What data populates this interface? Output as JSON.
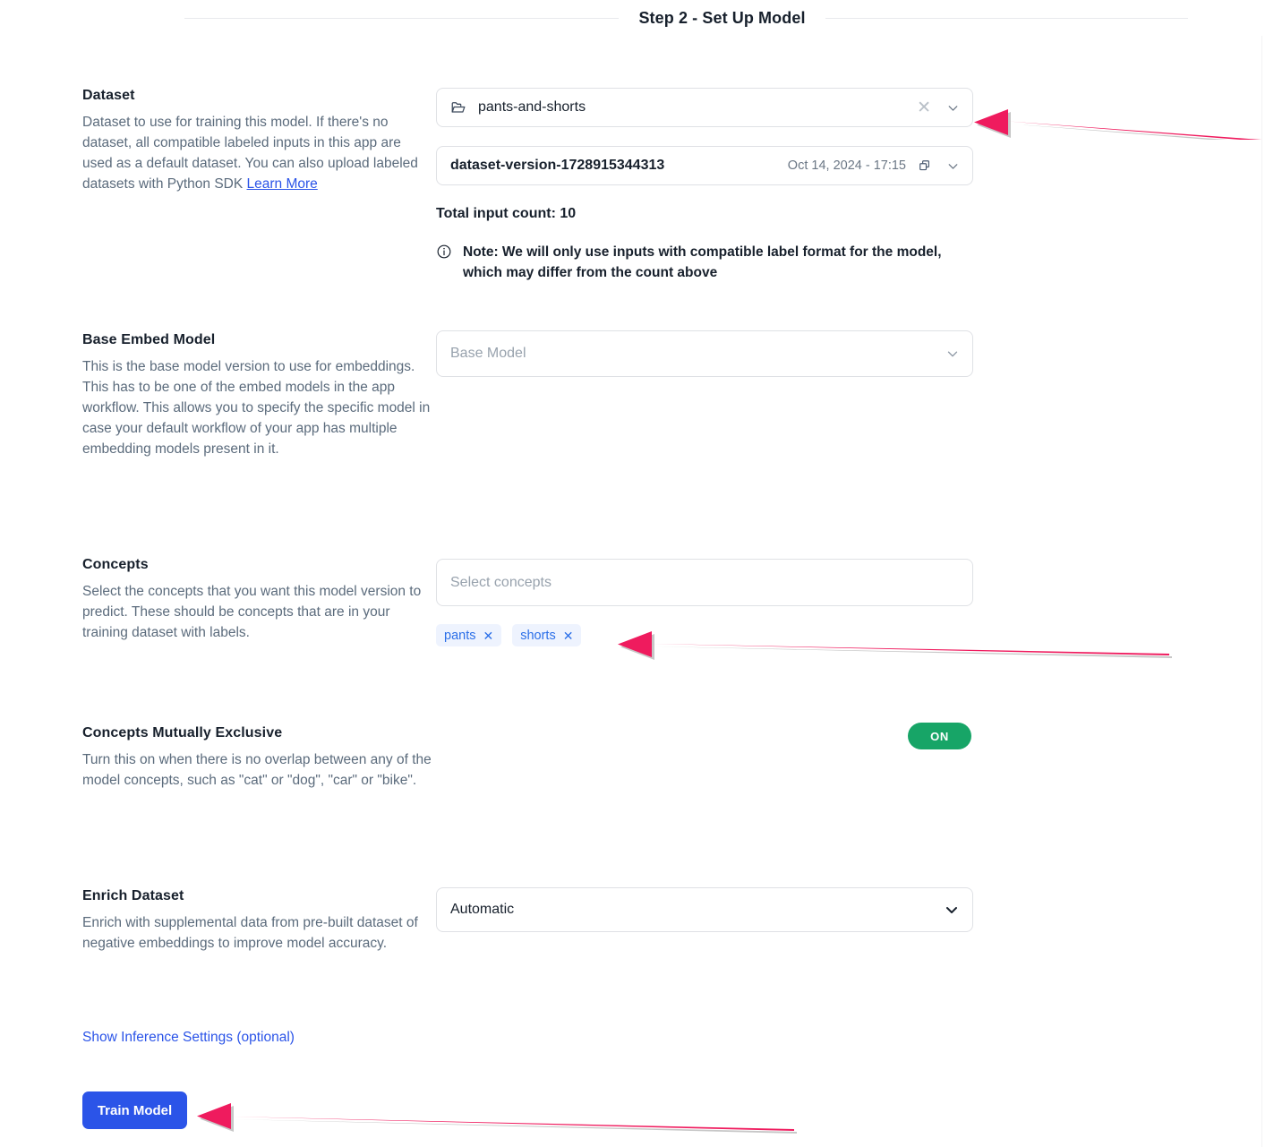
{
  "header": {
    "title": "Step 2 - Set Up Model"
  },
  "colors": {
    "accent_blue": "#2b54e8",
    "chip_blue": "#2b6fe8",
    "toggle_green": "#17a567",
    "annotation_pink": "#ef1b5e"
  },
  "sections": {
    "dataset": {
      "title": "Dataset",
      "description_before_link": "Dataset to use for training this model. If there's no dataset, all compatible labeled inputs in this app are used as a default dataset. You can also upload labeled datasets with Python SDK ",
      "link_text": "Learn More",
      "dataset_select": {
        "value": "pants-and-shorts",
        "folder_icon": "folder-open-icon",
        "clear_icon": "close-icon",
        "chevron_icon": "chevron-down-icon"
      },
      "version_select": {
        "value": "dataset-version-1728915344313",
        "date": "Oct 14, 2024 - 17:15",
        "copy_icon": "copy-icon",
        "chevron_icon": "chevron-down-icon"
      },
      "total_input_count": "Total input count: 10",
      "note_icon": "info-circle-icon",
      "note_text": "Note: We will only use inputs with compatible label format for the model, which may differ from the count above"
    },
    "base_embed_model": {
      "title": "Base Embed Model",
      "description": "This is the base model version to use for embeddings. This has to be one of the embed models in the app workflow. This allows you to specify the specific model in case your default workflow of your app has multiple embedding models present in it.",
      "select": {
        "placeholder": "Base Model",
        "value": "",
        "chevron_icon": "chevron-down-icon"
      }
    },
    "concepts": {
      "title": "Concepts",
      "description": "Select the concepts that you want this model version to predict. These should be concepts that are in your training dataset with labels.",
      "select": {
        "placeholder": "Select concepts"
      },
      "chips": [
        {
          "label": "pants",
          "remove_icon": "close-icon"
        },
        {
          "label": "shorts",
          "remove_icon": "close-icon"
        }
      ]
    },
    "concepts_mutually_exclusive": {
      "title": "Concepts Mutually Exclusive",
      "description": "Turn this on when there is no overlap between any of the model concepts, such as \"cat\" or \"dog\", \"car\" or \"bike\".",
      "toggle_label": "ON",
      "toggle_state": "on"
    },
    "enrich_dataset": {
      "title": "Enrich Dataset",
      "description": "Enrich with supplemental data from pre-built dataset of negative embeddings to improve model accuracy.",
      "select": {
        "value": "Automatic",
        "chevron_icon": "chevron-down-icon"
      }
    }
  },
  "footer": {
    "inference_settings_link": "Show Inference Settings (optional)",
    "train_button": "Train Model"
  }
}
